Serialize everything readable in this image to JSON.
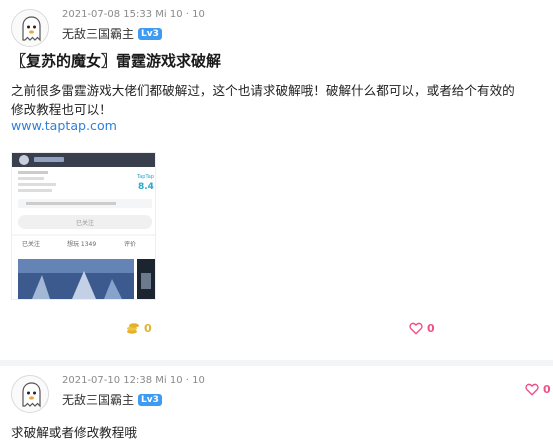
{
  "post1": {
    "timestamp": "2021-07-08 15:33 Mi 10 · 10",
    "username": "无敌三国霸主",
    "level": "Lv3",
    "title": "〖复苏的魔女〗雷霆游戏求破解",
    "body_line1": "之前很多雷霆游戏大佬们都破解过，这个也请求破解哦！破解什么都可以，或者给个有效的",
    "body_line2": "修改教程也可以！",
    "link": "www.taptap.com",
    "coin_count": "0",
    "like_count": "0",
    "screenshot": {
      "rating_label": "TapTap",
      "rating": "8.4",
      "button_text": "已关注",
      "follow_label": "已关注",
      "want_label": "想玩 1349",
      "review_label": "评价"
    }
  },
  "post2": {
    "timestamp": "2021-07-10 12:38 Mi 10 · 10",
    "username": "无敌三国霸主",
    "level": "Lv3",
    "like_count": "0",
    "reply": "求破解或者修改教程哦"
  },
  "colors": {
    "accent_blue": "#3e9bf2",
    "link_blue": "#2f7fd8",
    "coin_gold": "#e3b12a",
    "like_pink": "#f0508a",
    "separator": "#f3f4f6"
  },
  "icons": [
    "ghost-avatar",
    "coin-icon",
    "heart-icon"
  ]
}
